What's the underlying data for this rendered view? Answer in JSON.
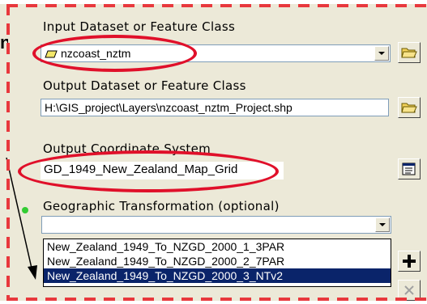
{
  "left_edge_glyph": "n",
  "input": {
    "label": "Input Dataset or Feature Class",
    "value": "nzcoast_nztm"
  },
  "output": {
    "label": "Output Dataset or Feature Class",
    "value": "H:\\GIS_project\\Layers\\nzcoast_nztm_Project.shp"
  },
  "coord": {
    "label": "Output Coordinate System",
    "value": "GD_1949_New_Zealand_Map_Grid"
  },
  "transform": {
    "label": "Geographic Transformation (optional)",
    "value": "",
    "options": [
      "New_Zealand_1949_To_NZGD_2000_1_3PAR",
      "New_Zealand_1949_To_NZGD_2000_2_7PAR",
      "New_Zealand_1949_To_NZGD_2000_3_NTv2"
    ],
    "selected_index": 2
  },
  "colors": {
    "annotation_red": "#e0102a",
    "selection_blue": "#0a246a",
    "dialog_bg": "#ece9d8"
  },
  "icons": {
    "open_folder": "open-folder-icon",
    "properties": "properties-icon",
    "add": "plus-icon",
    "remove": "x-icon",
    "polygon": "polygon-layer-icon",
    "annotation_arrow": "arrow-annotation"
  }
}
